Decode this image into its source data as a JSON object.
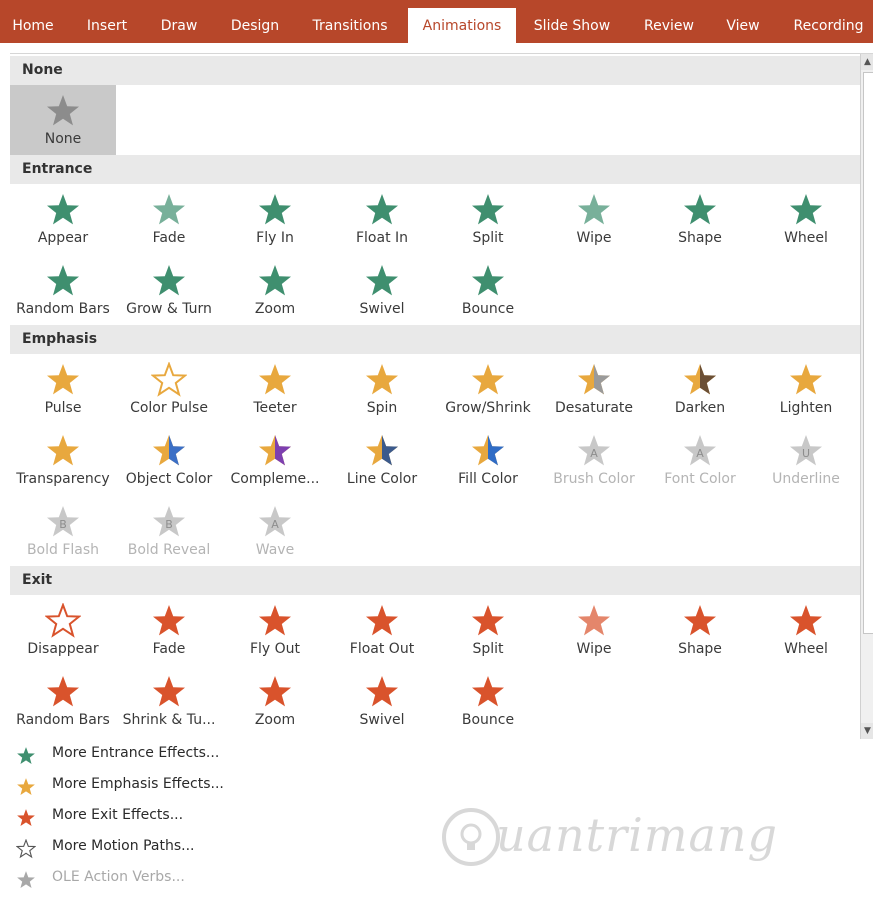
{
  "ribbon": {
    "tabs": [
      "Home",
      "Insert",
      "Draw",
      "Design",
      "Transitions",
      "Animations",
      "Slide Show",
      "Review",
      "View",
      "Recording"
    ],
    "active_tab": "Animations",
    "color": "#b7472a"
  },
  "gallery": {
    "none": {
      "header": "None",
      "items": [
        {
          "label": "None",
          "icon": "gray-star-icon",
          "selected": true
        }
      ]
    },
    "entrance": {
      "header": "Entrance",
      "color": "#3f8f6f",
      "items": [
        {
          "label": "Appear",
          "icon": "entrance-appear-icon"
        },
        {
          "label": "Fade",
          "icon": "entrance-fade-icon"
        },
        {
          "label": "Fly In",
          "icon": "entrance-fly-in-icon"
        },
        {
          "label": "Float In",
          "icon": "entrance-float-in-icon"
        },
        {
          "label": "Split",
          "icon": "entrance-split-icon"
        },
        {
          "label": "Wipe",
          "icon": "entrance-wipe-icon"
        },
        {
          "label": "Shape",
          "icon": "entrance-shape-icon"
        },
        {
          "label": "Wheel",
          "icon": "entrance-wheel-icon"
        },
        {
          "label": "Random Bars",
          "icon": "entrance-random-bars-icon"
        },
        {
          "label": "Grow & Turn",
          "icon": "entrance-grow-turn-icon"
        },
        {
          "label": "Zoom",
          "icon": "entrance-zoom-icon"
        },
        {
          "label": "Swivel",
          "icon": "entrance-swivel-icon"
        },
        {
          "label": "Bounce",
          "icon": "entrance-bounce-icon"
        }
      ]
    },
    "emphasis": {
      "header": "Emphasis",
      "color": "#e8a83e",
      "items": [
        {
          "label": "Pulse",
          "icon": "emphasis-pulse-icon"
        },
        {
          "label": "Color Pulse",
          "icon": "emphasis-color-pulse-icon"
        },
        {
          "label": "Teeter",
          "icon": "emphasis-teeter-icon"
        },
        {
          "label": "Spin",
          "icon": "emphasis-spin-icon"
        },
        {
          "label": "Grow/Shrink",
          "icon": "emphasis-grow-shrink-icon"
        },
        {
          "label": "Desaturate",
          "icon": "emphasis-desaturate-icon"
        },
        {
          "label": "Darken",
          "icon": "emphasis-darken-icon"
        },
        {
          "label": "Lighten",
          "icon": "emphasis-lighten-icon"
        },
        {
          "label": "Transparency",
          "icon": "emphasis-transparency-icon"
        },
        {
          "label": "Object Color",
          "icon": "emphasis-object-color-icon"
        },
        {
          "label": "Compleme...",
          "icon": "emphasis-complementary-icon"
        },
        {
          "label": "Line Color",
          "icon": "emphasis-line-color-icon"
        },
        {
          "label": "Fill Color",
          "icon": "emphasis-fill-color-icon"
        },
        {
          "label": "Brush Color",
          "icon": "emphasis-brush-color-icon",
          "disabled": true
        },
        {
          "label": "Font Color",
          "icon": "emphasis-font-color-icon",
          "disabled": true
        },
        {
          "label": "Underline",
          "icon": "emphasis-underline-icon",
          "disabled": true
        },
        {
          "label": "Bold Flash",
          "icon": "emphasis-bold-flash-icon",
          "disabled": true
        },
        {
          "label": "Bold Reveal",
          "icon": "emphasis-bold-reveal-icon",
          "disabled": true
        },
        {
          "label": "Wave",
          "icon": "emphasis-wave-icon",
          "disabled": true
        }
      ]
    },
    "exit": {
      "header": "Exit",
      "color": "#d9532c",
      "items": [
        {
          "label": "Disappear",
          "icon": "exit-disappear-icon"
        },
        {
          "label": "Fade",
          "icon": "exit-fade-icon"
        },
        {
          "label": "Fly Out",
          "icon": "exit-fly-out-icon"
        },
        {
          "label": "Float Out",
          "icon": "exit-float-out-icon"
        },
        {
          "label": "Split",
          "icon": "exit-split-icon"
        },
        {
          "label": "Wipe",
          "icon": "exit-wipe-icon"
        },
        {
          "label": "Shape",
          "icon": "exit-shape-icon"
        },
        {
          "label": "Wheel",
          "icon": "exit-wheel-icon"
        },
        {
          "label": "Random Bars",
          "icon": "exit-random-bars-icon"
        },
        {
          "label": "Shrink & Tu...",
          "icon": "exit-shrink-turn-icon"
        },
        {
          "label": "Zoom",
          "icon": "exit-zoom-icon"
        },
        {
          "label": "Swivel",
          "icon": "exit-swivel-icon"
        },
        {
          "label": "Bounce",
          "icon": "exit-bounce-icon"
        }
      ]
    }
  },
  "menu": [
    {
      "label": "More Entrance Effects...",
      "icon": "green-star-icon",
      "color": "#3f8f6f"
    },
    {
      "label": "More Emphasis Effects...",
      "icon": "gold-star-icon",
      "color": "#e8a83e"
    },
    {
      "label": "More Exit Effects...",
      "icon": "red-star-icon",
      "color": "#d9532c"
    },
    {
      "label": "More Motion Paths...",
      "icon": "motion-path-star-icon",
      "color": "#555555"
    },
    {
      "label": "OLE Action Verbs...",
      "icon": "gears-icon",
      "color": "#a8a8a8",
      "disabled": true
    }
  ],
  "watermark": {
    "text": "uantrimang",
    "icon": "quantrimang-logo-icon"
  }
}
